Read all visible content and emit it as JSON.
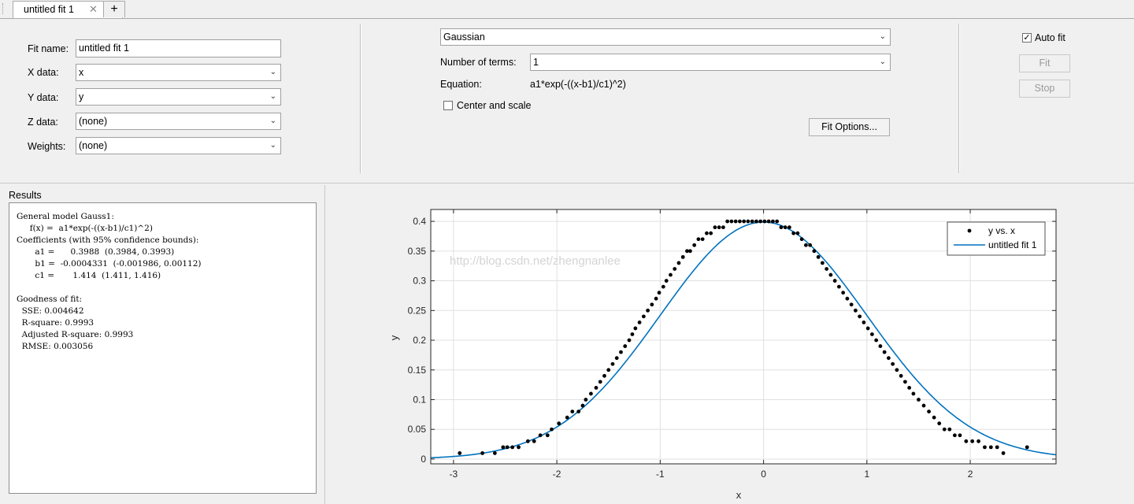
{
  "tab": {
    "label": "untitled fit 1",
    "close": "✕",
    "add": "+"
  },
  "data_selection": {
    "fit_name_label": "Fit name:",
    "fit_name_value": "untitled fit 1",
    "x_data_label": "X data:",
    "x_data_value": "x",
    "y_data_label": "Y data:",
    "y_data_value": "y",
    "z_data_label": "Z data:",
    "z_data_value": "(none)",
    "weights_label": "Weights:",
    "weights_value": "(none)"
  },
  "fit_type": {
    "model": "Gaussian",
    "terms_label": "Number of terms:",
    "terms_value": "1",
    "equation_label": "Equation:",
    "equation_value": "a1*exp(-((x-b1)/c1)^2)",
    "center_scale_label": "Center and scale",
    "center_scale_checked": false,
    "fit_options_label": "Fit Options..."
  },
  "actions": {
    "auto_fit_label": "Auto fit",
    "auto_fit_checked": true,
    "fit_label": "Fit",
    "stop_label": "Stop"
  },
  "results": {
    "title": "Results",
    "lines": [
      "General model Gauss1:",
      "     f(x) =  a1*exp(-((x-b1)/c1)^2)",
      "Coefficients (with 95% confidence bounds):",
      "       a1 =      0.3988  (0.3984, 0.3993)",
      "       b1 =  -0.0004331  (-0.001986, 0.00112)",
      "       c1 =       1.414  (1.411, 1.416)",
      "",
      "Goodness of fit:",
      "  SSE: 0.004642",
      "  R-square: 0.9993",
      "  Adjusted R-square: 0.9993",
      "  RMSE: 0.003056"
    ]
  },
  "watermark": "http://blog.csdn.net/zhengnanlee",
  "colors": {
    "fit_line": "#0072bd",
    "points": "#000000",
    "grid": "#e0e0e0"
  },
  "chart_data": {
    "type": "scatter",
    "xlabel": "x",
    "ylabel": "y",
    "xlim": [
      -3.22,
      2.83
    ],
    "ylim": [
      -0.008,
      0.42
    ],
    "xticks": [
      -3,
      -2,
      -1,
      0,
      1,
      2
    ],
    "yticks": [
      0,
      0.05,
      0.1,
      0.15,
      0.2,
      0.25,
      0.3,
      0.35,
      0.4
    ],
    "ytick_labels": [
      "0",
      "0.05",
      "0.1",
      "0.15",
      "0.2",
      "0.25",
      "0.3",
      "0.35",
      "0.4"
    ],
    "grid": true,
    "legend_position": "top-right",
    "series": [
      {
        "name": "y vs. x",
        "kind": "points",
        "x": [
          -2.94,
          -2.72,
          -2.6,
          -2.52,
          -2.48,
          -2.43,
          -2.37,
          -2.28,
          -2.22,
          -2.16,
          -2.09,
          -2.05,
          -1.98,
          -1.9,
          -1.85,
          -1.79,
          -1.75,
          -1.72,
          -1.67,
          -1.62,
          -1.58,
          -1.54,
          -1.5,
          -1.46,
          -1.42,
          -1.38,
          -1.34,
          -1.3,
          -1.27,
          -1.24,
          -1.2,
          -1.16,
          -1.12,
          -1.08,
          -1.04,
          -1.01,
          -0.97,
          -0.94,
          -0.9,
          -0.86,
          -0.82,
          -0.78,
          -0.74,
          -0.71,
          -0.67,
          -0.63,
          -0.59,
          -0.55,
          -0.51,
          -0.47,
          -0.43,
          -0.39,
          -0.35,
          -0.31,
          -0.27,
          -0.23,
          -0.19,
          -0.15,
          -0.11,
          -0.07,
          -0.03,
          0.01,
          0.05,
          0.09,
          0.13,
          0.17,
          0.21,
          0.25,
          0.29,
          0.33,
          0.37,
          0.41,
          0.45,
          0.49,
          0.53,
          0.57,
          0.61,
          0.65,
          0.69,
          0.73,
          0.77,
          0.81,
          0.85,
          0.89,
          0.93,
          0.97,
          1.01,
          1.05,
          1.09,
          1.13,
          1.17,
          1.21,
          1.25,
          1.29,
          1.33,
          1.37,
          1.41,
          1.45,
          1.5,
          1.55,
          1.6,
          1.65,
          1.7,
          1.75,
          1.8,
          1.85,
          1.9,
          1.96,
          2.02,
          2.08,
          2.14,
          2.2,
          2.26,
          2.32,
          2.55
        ],
        "y": [
          0.01,
          0.01,
          0.01,
          0.02,
          0.02,
          0.02,
          0.02,
          0.03,
          0.03,
          0.04,
          0.04,
          0.05,
          0.06,
          0.07,
          0.08,
          0.08,
          0.09,
          0.1,
          0.11,
          0.12,
          0.13,
          0.14,
          0.15,
          0.16,
          0.17,
          0.18,
          0.19,
          0.2,
          0.21,
          0.22,
          0.23,
          0.24,
          0.25,
          0.26,
          0.27,
          0.28,
          0.29,
          0.3,
          0.31,
          0.32,
          0.33,
          0.34,
          0.35,
          0.35,
          0.36,
          0.37,
          0.37,
          0.38,
          0.38,
          0.39,
          0.39,
          0.39,
          0.4,
          0.4,
          0.4,
          0.4,
          0.4,
          0.4,
          0.4,
          0.4,
          0.4,
          0.4,
          0.4,
          0.4,
          0.4,
          0.39,
          0.39,
          0.39,
          0.38,
          0.38,
          0.37,
          0.36,
          0.36,
          0.35,
          0.34,
          0.33,
          0.32,
          0.31,
          0.3,
          0.29,
          0.28,
          0.27,
          0.26,
          0.25,
          0.24,
          0.23,
          0.22,
          0.21,
          0.2,
          0.19,
          0.18,
          0.17,
          0.16,
          0.15,
          0.14,
          0.13,
          0.12,
          0.11,
          0.1,
          0.09,
          0.08,
          0.07,
          0.06,
          0.05,
          0.05,
          0.04,
          0.04,
          0.03,
          0.03,
          0.03,
          0.02,
          0.02,
          0.02,
          0.01,
          0.02
        ]
      },
      {
        "name": "untitled fit 1",
        "kind": "curve",
        "a1": 0.3988,
        "b1": -0.0004331,
        "c1": 1.414
      }
    ]
  }
}
